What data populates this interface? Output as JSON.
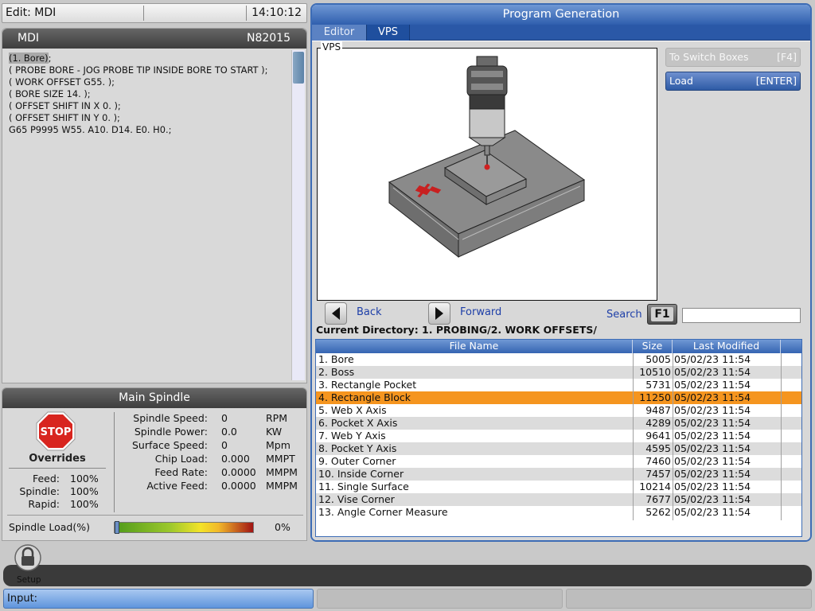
{
  "status": {
    "edit_mode": "Edit: MDI",
    "clock": "14:10:12"
  },
  "mdi": {
    "title": "MDI",
    "program_number": "N82015",
    "code_lines": [
      {
        "highlight": "(1. Bore)",
        "rest": ";"
      },
      {
        "highlight": "",
        "rest": "( PROBE BORE - JOG PROBE TIP INSIDE BORE TO START );"
      },
      {
        "highlight": "",
        "rest": "( WORK OFFSET G55. );"
      },
      {
        "highlight": "",
        "rest": "( BORE SIZE 14. );"
      },
      {
        "highlight": "",
        "rest": "( OFFSET SHIFT IN X 0. );"
      },
      {
        "highlight": "",
        "rest": "( OFFSET SHIFT IN Y 0. );"
      },
      {
        "highlight": "",
        "rest": "G65 P9995 W55. A10. D14. E0. H0.;"
      }
    ]
  },
  "spindle": {
    "title": "Main Spindle",
    "stop_label": "STOP",
    "overrides_title": "Overrides",
    "overrides": [
      {
        "label": "Feed:",
        "value": "100%"
      },
      {
        "label": "Spindle:",
        "value": "100%"
      },
      {
        "label": "Rapid:",
        "value": "100%"
      }
    ],
    "stats": [
      {
        "label": "Spindle Speed:",
        "value": "0",
        "unit": "RPM"
      },
      {
        "label": "Spindle Power:",
        "value": "0.0",
        "unit": "KW"
      },
      {
        "label": "Surface Speed:",
        "value": "0",
        "unit": "Mpm"
      },
      {
        "label": "Chip Load:",
        "value": "0.000",
        "unit": "MMPT"
      },
      {
        "label": "Feed Rate:",
        "value": "0.0000",
        "unit": "MMPM"
      },
      {
        "label": "Active Feed:",
        "value": "0.0000",
        "unit": "MMPM"
      }
    ],
    "load_label": "Spindle Load(%)",
    "load_value": "0%",
    "load_fraction": 0
  },
  "program_generation": {
    "title": "Program Generation",
    "tabs": [
      {
        "label": "Editor"
      },
      {
        "label": "VPS"
      }
    ],
    "active_tab": "VPS",
    "vps_label": "VPS",
    "switch_boxes": {
      "label": "To Switch Boxes",
      "key": "[F4]"
    },
    "load": {
      "label": "Load",
      "key": "[ENTER]"
    },
    "back_label": "Back",
    "forward_label": "Forward",
    "search_label": "Search",
    "search_key": "F1",
    "search_value": "",
    "current_directory": "Current Directory: 1. PROBING/2. WORK OFFSETS/",
    "columns": {
      "name": "File Name",
      "size": "Size",
      "modified": "Last Modified"
    },
    "selected_index": 3,
    "files": [
      {
        "name": "1. Bore",
        "size": "5005",
        "modified": "05/02/23 11:54"
      },
      {
        "name": "2. Boss",
        "size": "10510",
        "modified": "05/02/23 11:54"
      },
      {
        "name": "3. Rectangle Pocket",
        "size": "5731",
        "modified": "05/02/23 11:54"
      },
      {
        "name": "4. Rectangle Block",
        "size": "11250",
        "modified": "05/02/23 11:54"
      },
      {
        "name": "5. Web X Axis",
        "size": "9487",
        "modified": "05/02/23 11:54"
      },
      {
        "name": "6. Pocket X Axis",
        "size": "4289",
        "modified": "05/02/23 11:54"
      },
      {
        "name": "7. Web Y Axis",
        "size": "9641",
        "modified": "05/02/23 11:54"
      },
      {
        "name": "8. Pocket Y Axis",
        "size": "4595",
        "modified": "05/02/23 11:54"
      },
      {
        "name": "9. Outer Corner",
        "size": "7460",
        "modified": "05/02/23 11:54"
      },
      {
        "name": "10. Inside Corner",
        "size": "7457",
        "modified": "05/02/23 11:54"
      },
      {
        "name": "11. Single Surface",
        "size": "10214",
        "modified": "05/02/23 11:54"
      },
      {
        "name": "12. Vise Corner",
        "size": "7677",
        "modified": "05/02/23 11:54"
      },
      {
        "name": "13. Angle Corner Measure",
        "size": "5262",
        "modified": "05/02/23 11:54"
      }
    ]
  },
  "bottom": {
    "setup_label": "Setup",
    "input_label": "Input:"
  }
}
